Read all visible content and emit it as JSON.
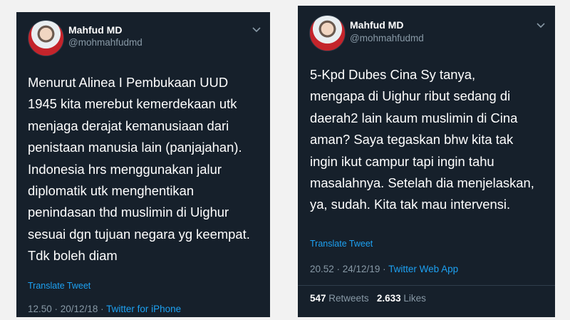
{
  "tweets": [
    {
      "name": "Mahfud MD",
      "handle": "@mohmahfudmd",
      "lines": [
        "Menurut Alinea I Pembukaan UUD",
        "1945 kita merebut kemerdekaan utk",
        "menjaga derajat kemanusiaan dari",
        "penistaan manusia lain (panjajahan).",
        "Indonesia hrs menggunakan jalur",
        "diplomatik utk menghentikan",
        "penindasan thd muslimin di Uighur",
        "sesuai dgn tujuan negara yg keempat.",
        "Tdk boleh diam"
      ],
      "translate": "Translate Tweet",
      "time": "12.50 · 20/12/18 ·",
      "app": "Twitter for iPhone"
    },
    {
      "name": "Mahfud MD",
      "handle": "@mohmahfudmd",
      "lines": [
        "5-Kpd Dubes Cina Sy tanya,",
        "mengapa di Uighur ribut sedang di",
        "daerah2 lain kaum muslimin di Cina",
        "aman? Saya tegaskan bhw kita tak",
        "ingin ikut campur tapi ingin tahu",
        "masalahnya. Setelah dia menjelaskan,",
        "ya, sudah. Kita tak mau intervensi."
      ],
      "translate": "Translate Tweet",
      "time": "20.52 · 24/12/19 ·",
      "app": "Twitter Web App",
      "retweets_count": "547",
      "retweets_label": "Retweets",
      "likes_count": "2.633",
      "likes_label": "Likes"
    }
  ],
  "icons": {
    "avatar": "profile-photo",
    "menu": "chevron-down-icon"
  },
  "colors": {
    "panel_bg": "#16202b",
    "link": "#1da1f2",
    "muted": "#8899a6",
    "text": "#ffffff"
  }
}
